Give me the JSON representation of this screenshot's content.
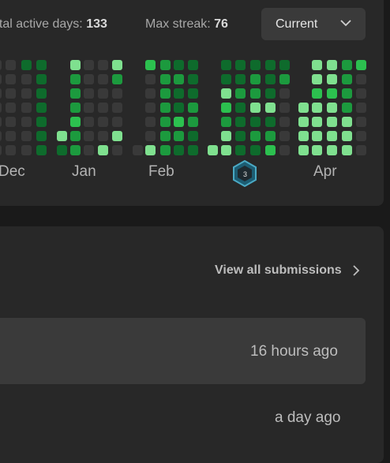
{
  "stats": {
    "total_label": "otal active days:",
    "total_value": "133",
    "streak_label": "Max streak:",
    "streak_value": "76"
  },
  "dropdown": {
    "selected": "Current",
    "icon": "chevron-down-icon"
  },
  "months": [
    "Dec",
    "Jan",
    "Feb",
    "Apr"
  ],
  "badge": {
    "icon": "hexagon-badge-icon",
    "text": "3"
  },
  "colors": {
    "empty": "#393939",
    "level1": "#0e6b2c",
    "level2": "#1c9a3e",
    "level3": "#2cc04f",
    "level4": "#7fe08f"
  },
  "submissions": {
    "view_all": "View all submissions",
    "items": [
      {
        "time": "16 hours ago"
      },
      {
        "time": "a day ago"
      }
    ]
  }
}
